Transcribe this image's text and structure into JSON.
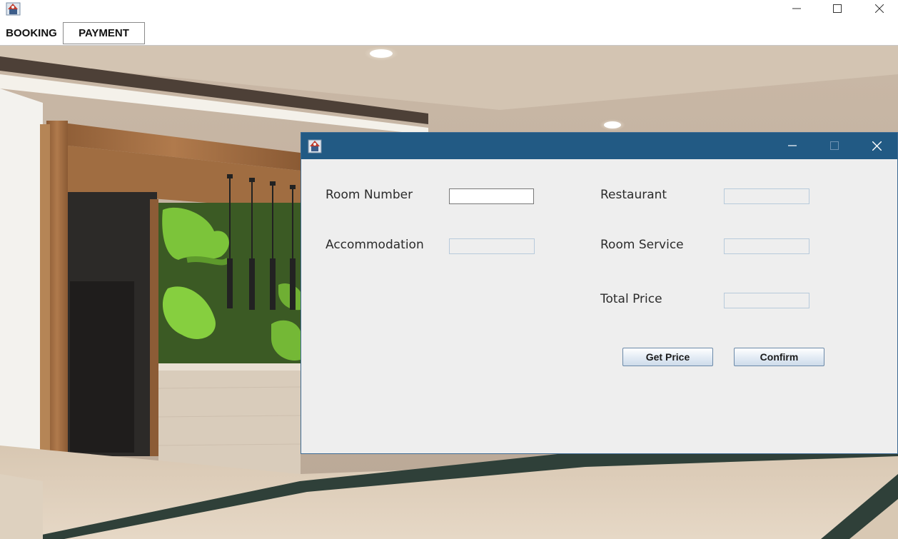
{
  "menu": {
    "booking": "BOOKING",
    "payment": "PAYMENT"
  },
  "dialog": {
    "labels": {
      "room_number": "Room Number",
      "accommodation": "Accommodation",
      "restaurant": "Restaurant",
      "room_service": "Room Service",
      "total_price": "Total Price"
    },
    "fields": {
      "room_number": "",
      "accommodation": "",
      "restaurant": "",
      "room_service": "",
      "total_price": ""
    },
    "buttons": {
      "get_price": "Get Price",
      "confirm": "Confirm"
    }
  },
  "colors": {
    "dialog_title_bar": "#225a84",
    "dialog_body": "#eeeeee"
  }
}
